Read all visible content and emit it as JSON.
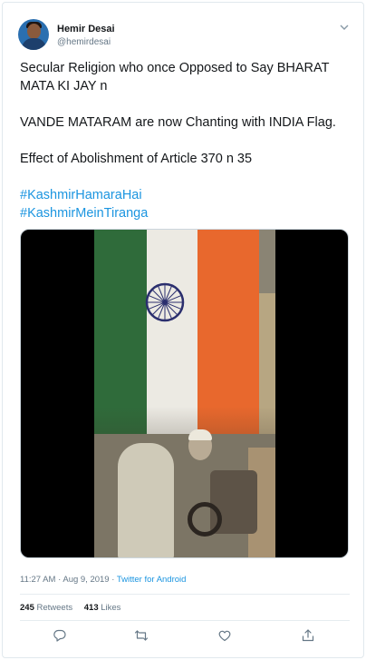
{
  "tweet": {
    "author_name": "Hemir Desai",
    "author_handle": "@hemirdesai",
    "lines": [
      "Secular Religion who once Opposed to Say BHARAT MATA KI JAY n",
      "VANDE MATARAM are now Chanting with INDIA Flag.",
      "Effect of Abolishment of Article 370 n 35"
    ],
    "hashtags": [
      "#KashmirHamaraHai",
      "#KashmirMeinTiranga"
    ],
    "timestamp": "11:27 AM · Aug 9, 2019 · ",
    "source": "Twitter for Android",
    "retweets_count": "245",
    "retweets_label": "Retweets",
    "likes_count": "413",
    "likes_label": "Likes"
  },
  "icons": {
    "caret": "chevron-down-icon",
    "reply": "reply-icon",
    "retweet": "retweet-icon",
    "like": "heart-icon",
    "share": "share-icon"
  },
  "colors": {
    "link": "#1b95e0",
    "secondary_text": "#657786",
    "border": "#e1e8ed"
  }
}
